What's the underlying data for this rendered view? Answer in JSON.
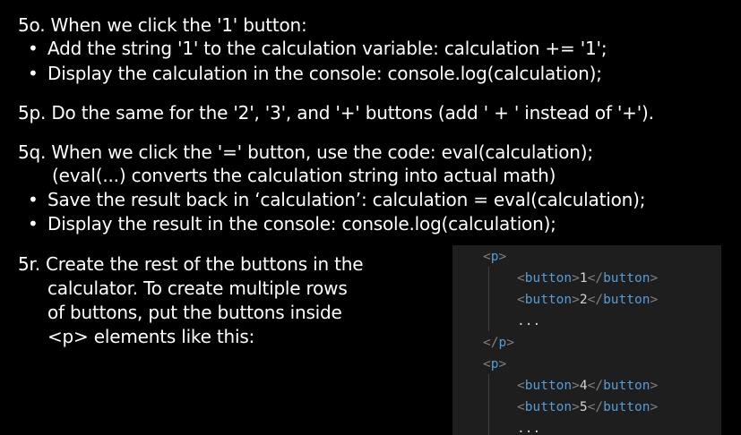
{
  "steps": {
    "s5o": {
      "heading": "5o. When we click the '1' button:",
      "bullets": [
        "Add the string '1' to the calculation variable: calculation += '1';",
        "Display the calculation in the console: console.log(calculation);"
      ]
    },
    "s5p": {
      "heading": "5p. Do the same for the '2', '3', and '+' buttons (add ' + ' instead of '+')."
    },
    "s5q": {
      "heading": "5q. When we click the '=' button, use the code: eval(calculation);",
      "subline": "(eval(...) converts the calculation string into actual math)",
      "bullets": [
        "Save the result back in ‘calculation’: calculation = eval(calculation);",
        "Display the result in the console: console.log(calculation);"
      ]
    },
    "s5r": {
      "lines": [
        "5r. Create the rest of the buttons in the",
        "calculator. To create multiple rows",
        "of buttons, put the buttons inside",
        "<p> elements like this:"
      ]
    }
  },
  "bullet_glyph": "•",
  "code": {
    "p_tag": "p",
    "button_tag": "button",
    "open": "<",
    "close": ">",
    "close_open": "</",
    "rows": [
      {
        "button1": "1",
        "button2": "2"
      },
      {
        "button1": "4",
        "button2": "5"
      }
    ],
    "ellipsis": "..."
  },
  "colors": {
    "background": "#000000",
    "text": "#ffffff",
    "code_bg": "#1e1e1e",
    "code_tag": "#569cd6",
    "code_bracket": "#808080",
    "code_text": "#d4d4d4"
  }
}
